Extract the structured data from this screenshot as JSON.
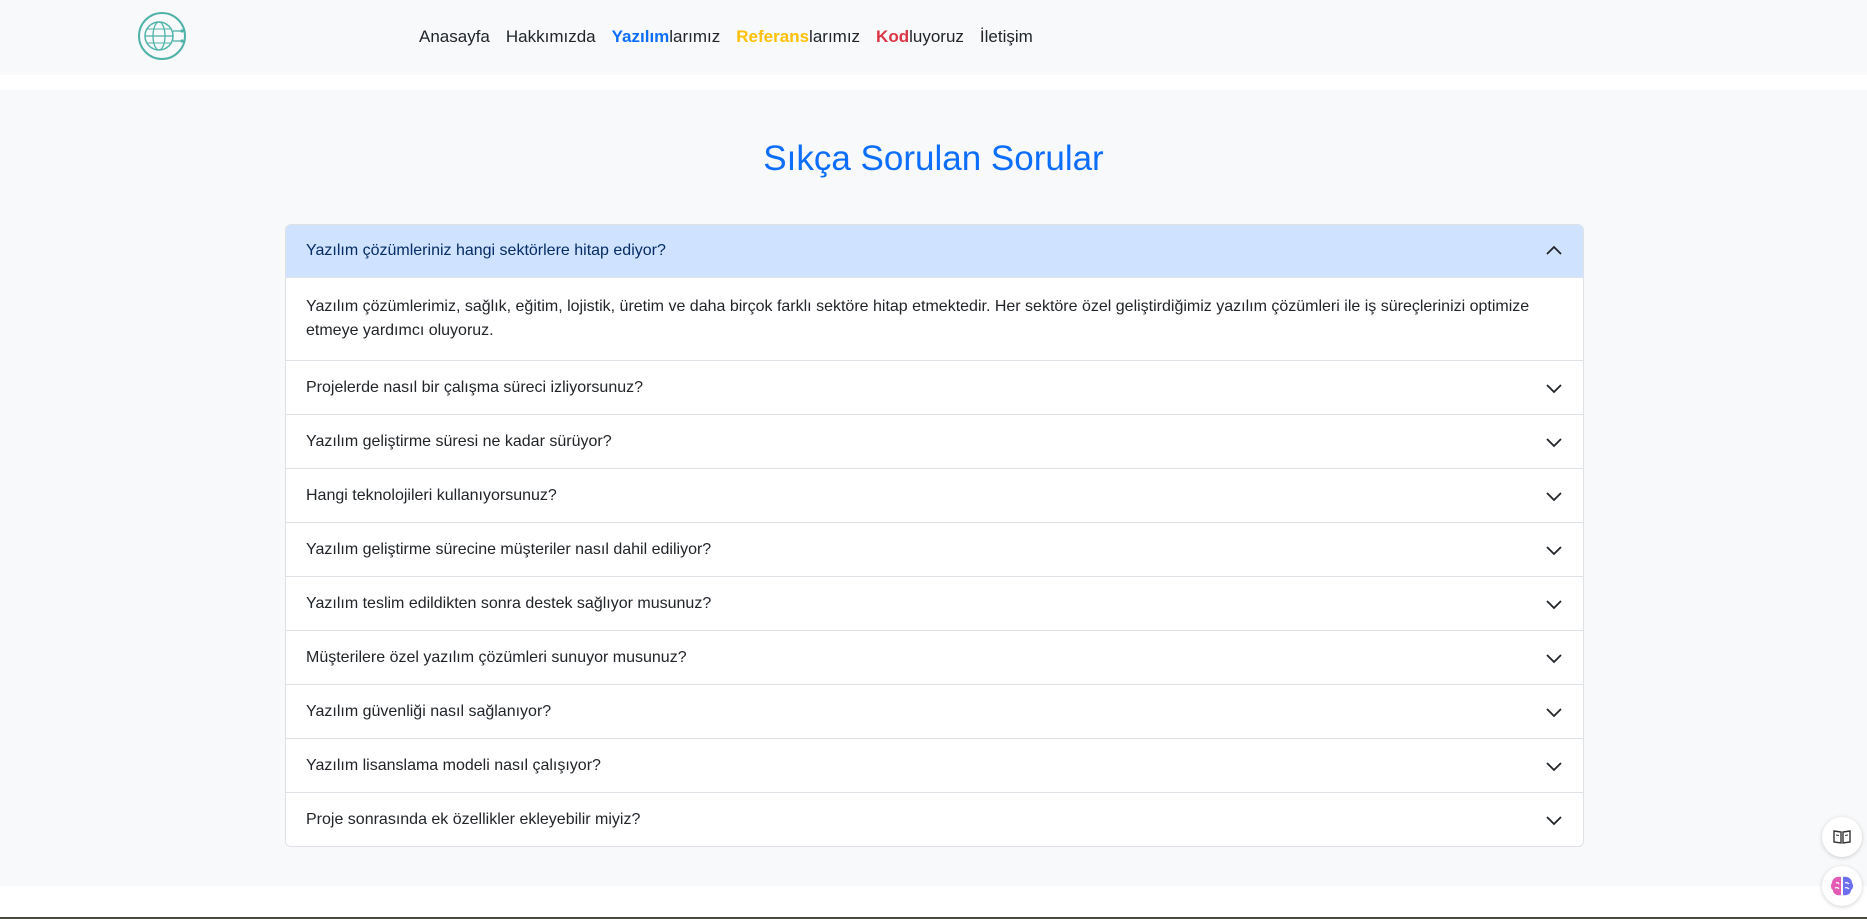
{
  "nav": {
    "links": [
      {
        "plain_before": "Anasayfa",
        "highlight": "",
        "plain_after": "",
        "highlight_color": ""
      },
      {
        "plain_before": "Hakkımızda",
        "highlight": "",
        "plain_after": "",
        "highlight_color": ""
      },
      {
        "plain_before": "",
        "highlight": "Yazılım",
        "plain_after": "larımız",
        "highlight_color": "#0d6efd"
      },
      {
        "plain_before": "",
        "highlight": "Referans",
        "plain_after": "larımız",
        "highlight_color": "#ffc107"
      },
      {
        "plain_before": "",
        "highlight": "Kod",
        "plain_after": "luyoruz",
        "highlight_color": "#dc3545"
      },
      {
        "plain_before": "İletişim",
        "highlight": "",
        "plain_after": "",
        "highlight_color": ""
      }
    ]
  },
  "faq": {
    "title": "Sıkça Sorulan Sorular",
    "items": [
      {
        "question": "Yazılım çözümleriniz hangi sektörlere hitap ediyor?",
        "answer": "Yazılım çözümlerimiz, sağlık, eğitim, lojistik, üretim ve daha birçok farklı sektöre hitap etmektedir. Her sektöre özel geliştirdiğimiz yazılım çözümleri ile iş süreçlerinizi optimize etmeye yardımcı oluyoruz.",
        "open": true
      },
      {
        "question": "Projelerde nasıl bir çalışma süreci izliyorsunuz?",
        "open": false
      },
      {
        "question": "Yazılım geliştirme süresi ne kadar sürüyor?",
        "open": false
      },
      {
        "question": "Hangi teknolojileri kullanıyorsunuz?",
        "open": false
      },
      {
        "question": "Yazılım geliştirme sürecine müşteriler nasıl dahil ediliyor?",
        "open": false
      },
      {
        "question": "Yazılım teslim edildikten sonra destek sağlıyor musunuz?",
        "open": false
      },
      {
        "question": "Müşterilere özel yazılım çözümleri sunuyor musunuz?",
        "open": false
      },
      {
        "question": "Yazılım güvenliği nasıl sağlanıyor?",
        "open": false
      },
      {
        "question": "Yazılım lisanslama modeli nasıl çalışıyor?",
        "open": false
      },
      {
        "question": "Proje sonrasında ek özellikler ekleyebilir miyiz?",
        "open": false
      }
    ]
  },
  "icons": {
    "logo": "globe-circuit-logo",
    "reader": "reader-icon",
    "assistant": "brain-icon",
    "open_chevron": "chevron-up-icon",
    "closed_chevron": "chevron-down-icon"
  },
  "colors": {
    "primary": "#0d6efd",
    "active_header": "#cfe2ff",
    "page_bg": "#f8f9fa"
  }
}
